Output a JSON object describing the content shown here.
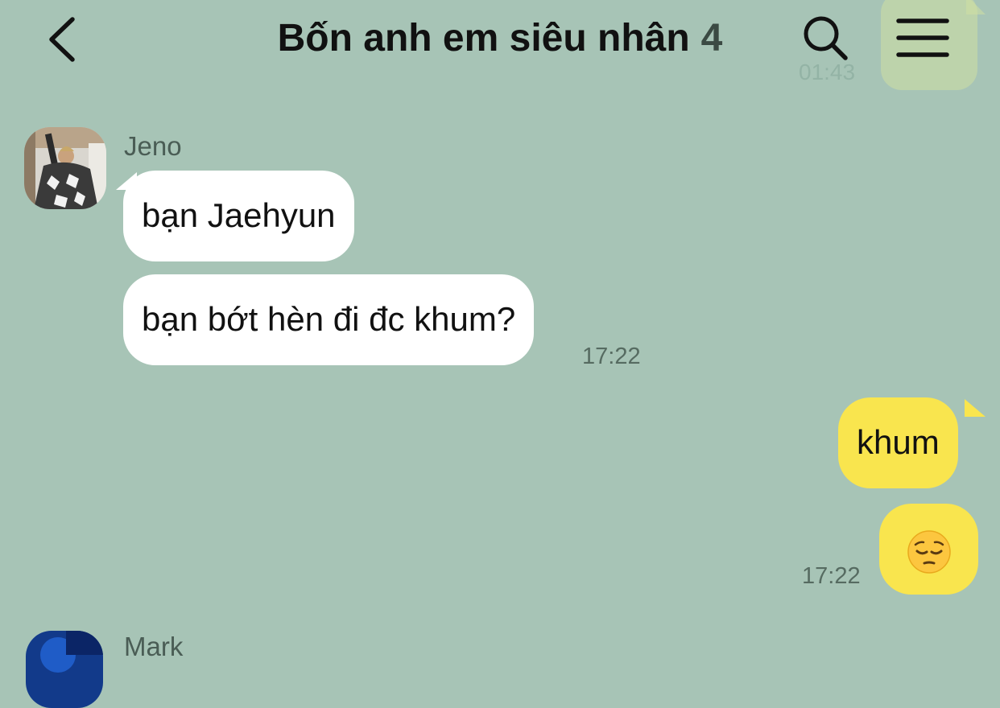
{
  "header": {
    "title": "Bốn anh em siêu nhân",
    "member_count": "4",
    "icons": {
      "back": "chevron-left-icon",
      "search": "search-icon",
      "menu": "hamburger-menu-icon"
    }
  },
  "ghost": {
    "time": "01:43"
  },
  "messages": [
    {
      "sender": "Jeno",
      "side": "incoming",
      "bubbles": [
        {
          "text": "bạn Jaehyun"
        },
        {
          "text": "bạn bớt hèn đi đc khum?"
        }
      ],
      "time": "17:22"
    },
    {
      "side": "outgoing",
      "bubbles": [
        {
          "text": "khum"
        },
        {
          "emoji": "pensive-face"
        }
      ],
      "time": "17:22"
    },
    {
      "sender": "Mark",
      "side": "incoming"
    }
  ],
  "colors": {
    "background": "#a7c4b6",
    "incoming_bubble": "#ffffff",
    "outgoing_bubble": "#f9e54e",
    "timestamp": "#566b61"
  }
}
